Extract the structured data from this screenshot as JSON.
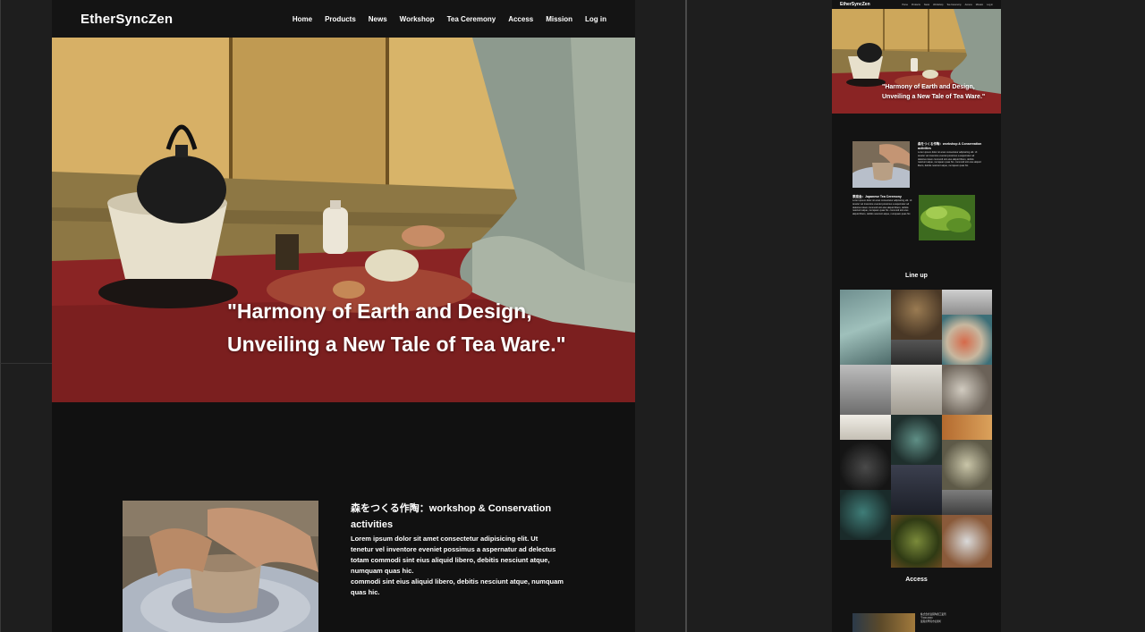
{
  "site": {
    "brand": "EtherSyncZen",
    "nav": [
      "Home",
      "Products",
      "News",
      "Workshop",
      "Tea Ceremony",
      "Access",
      "Mission",
      "Log in"
    ]
  },
  "hero": {
    "quote_line1": "\"Harmony of Earth and Design,",
    "quote_line2": "Unveiling a New Tale of Tea Ware.\""
  },
  "feature": {
    "title": "森をつくる作陶：workshop & Conservation activities",
    "body_lines": [
      "Lorem ipsum dolor sit amet consectetur adipisicing elit. Ut",
      "tenetur vel inventore eveniet possimus a aspernatur ad delectus",
      "totam commodi sint eius aliquid libero, debitis nesciunt atque,",
      "numquam quas hic.",
      "commodi sint eius aliquid libero, debitis nesciunt atque, numquam",
      "quas hic."
    ]
  },
  "mobile": {
    "brand": "EtherSyncZen",
    "nav": [
      "Home",
      "Products",
      "News",
      "Workshop",
      "Tea Ceremony",
      "Access",
      "Mission",
      "Log in"
    ],
    "quote_line1": "\"Harmony of Earth and Design,",
    "quote_line2": "Unveiling a New Tale of Tea Ware.\"",
    "feature1_title": "森をつくる作陶：workshop & Conservation activities",
    "feature1_body": "Lorem ipsum dolor sit amet consectetur adipisicing elit. Ut tenetur vel inventore eveniet possimus a aspernatur ad delectus totam commodi sint eius aliquid libero, debitis nesciunt atque, numquam quas hic. commodi sint eius aliquid libero, debitis nesciunt atque, numquam quas hic.",
    "feature2_title": "茶席会：Japanese Tea Ceremony",
    "feature2_body": "Lorem ipsum dolor sit amet consectetur adipisicing elit. Ut tenetur vel inventore eveniet possimus a aspernatur ad delectus totam commodi sint eius aliquid libero, debitis nesciunt atque, numquam quas hic. commodi sint eius aliquid libero, debitis nesciunt atque, numquam quas hic.",
    "lineup_heading": "Line up",
    "access_heading": "Access",
    "access_text_1": "株式会社滋賀陶器工業所",
    "access_text_2": "〒000-0000",
    "access_text_3": "滋賀県甲賀市信楽町"
  },
  "colors": {
    "page_bg": "#111111",
    "canvas_bg": "#1e1e1e",
    "hero_red": "#8a2424",
    "tatami_gold": "#caa257"
  }
}
